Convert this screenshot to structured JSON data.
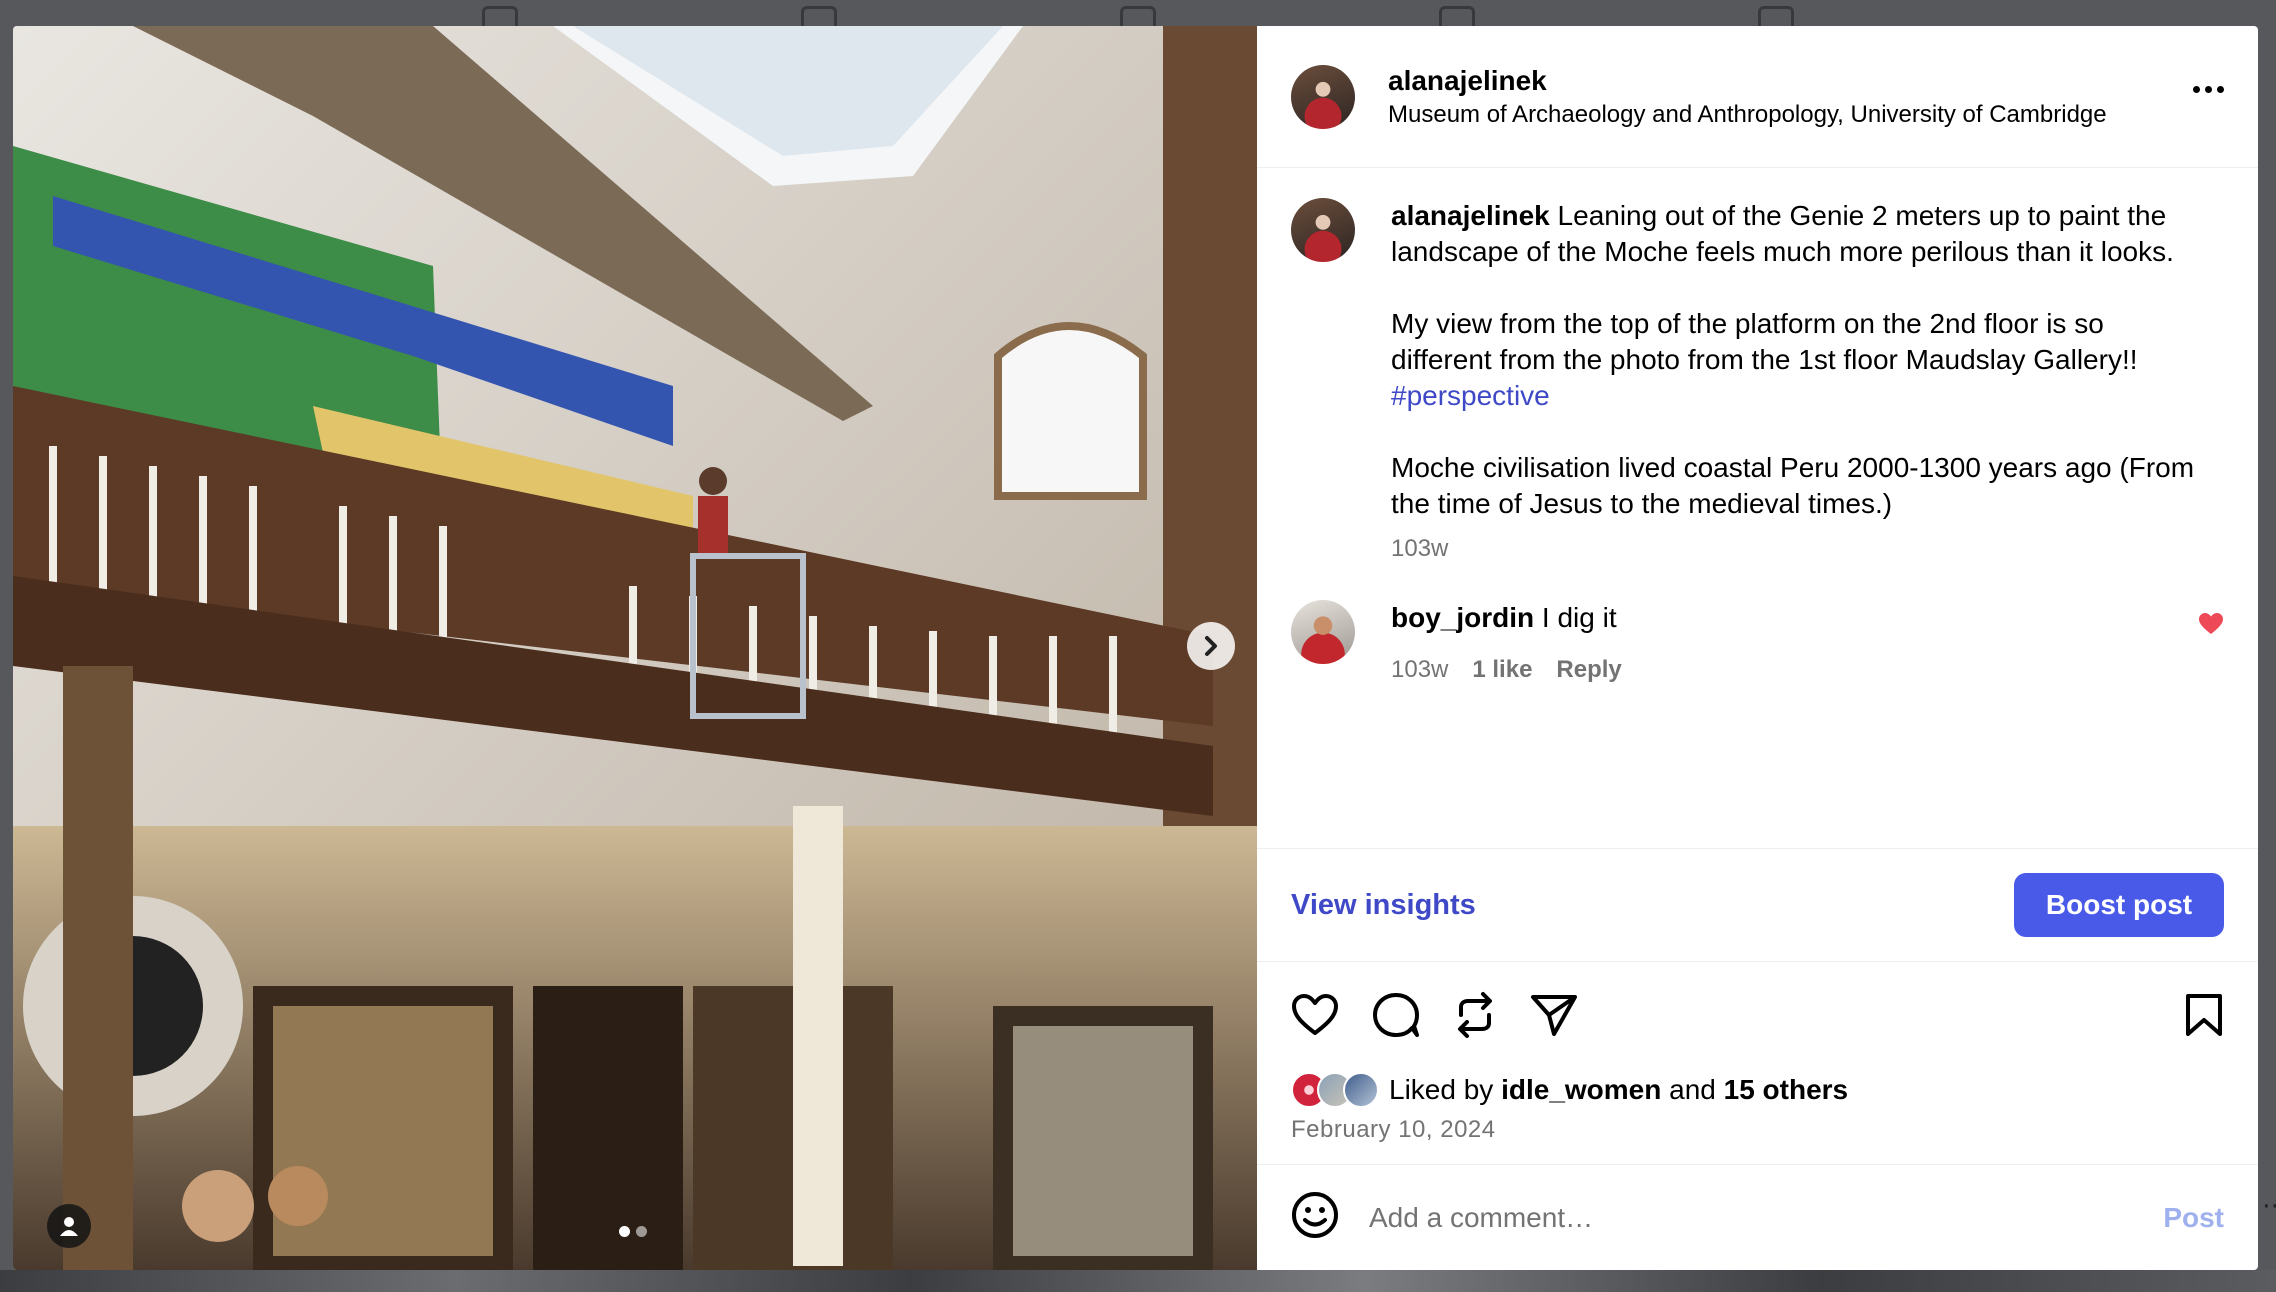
{
  "post": {
    "username": "alanajelinek",
    "location": "Museum of Archaeology and Anthropology, University of Cambridge",
    "caption_user": "alanajelinek",
    "caption_p1": "Leaning out of the Genie 2 meters up to paint the landscape of the Moche feels much more perilous than it looks.",
    "caption_p2": "My view from the top of the platform on the 2nd floor is so different from the photo from the 1st floor Maudslay Gallery!!",
    "hashtag": "#perspective",
    "caption_p3": "Moche civilisation lived coastal Peru 2000-1300 years ago (From the time of Jesus to the medieval times.)",
    "caption_time": "103w"
  },
  "comment": {
    "user": "boy_jordin",
    "text": "I dig it",
    "time": "103w",
    "likes": "1 like",
    "reply": "Reply"
  },
  "insights": {
    "link": "View insights",
    "boost": "Boost post"
  },
  "likes": {
    "prefix": "Liked by",
    "user": "idle_women",
    "and": "and",
    "others": "15 others"
  },
  "date": "February 10, 2024",
  "add_comment": {
    "placeholder": "Add a comment…",
    "post": "Post"
  },
  "carousel": {
    "slides": 2,
    "current": 1
  },
  "colors": {
    "accent": "#4a5ae8",
    "link": "#3f49c7",
    "heart": "#ed4956",
    "muted": "#737373"
  }
}
